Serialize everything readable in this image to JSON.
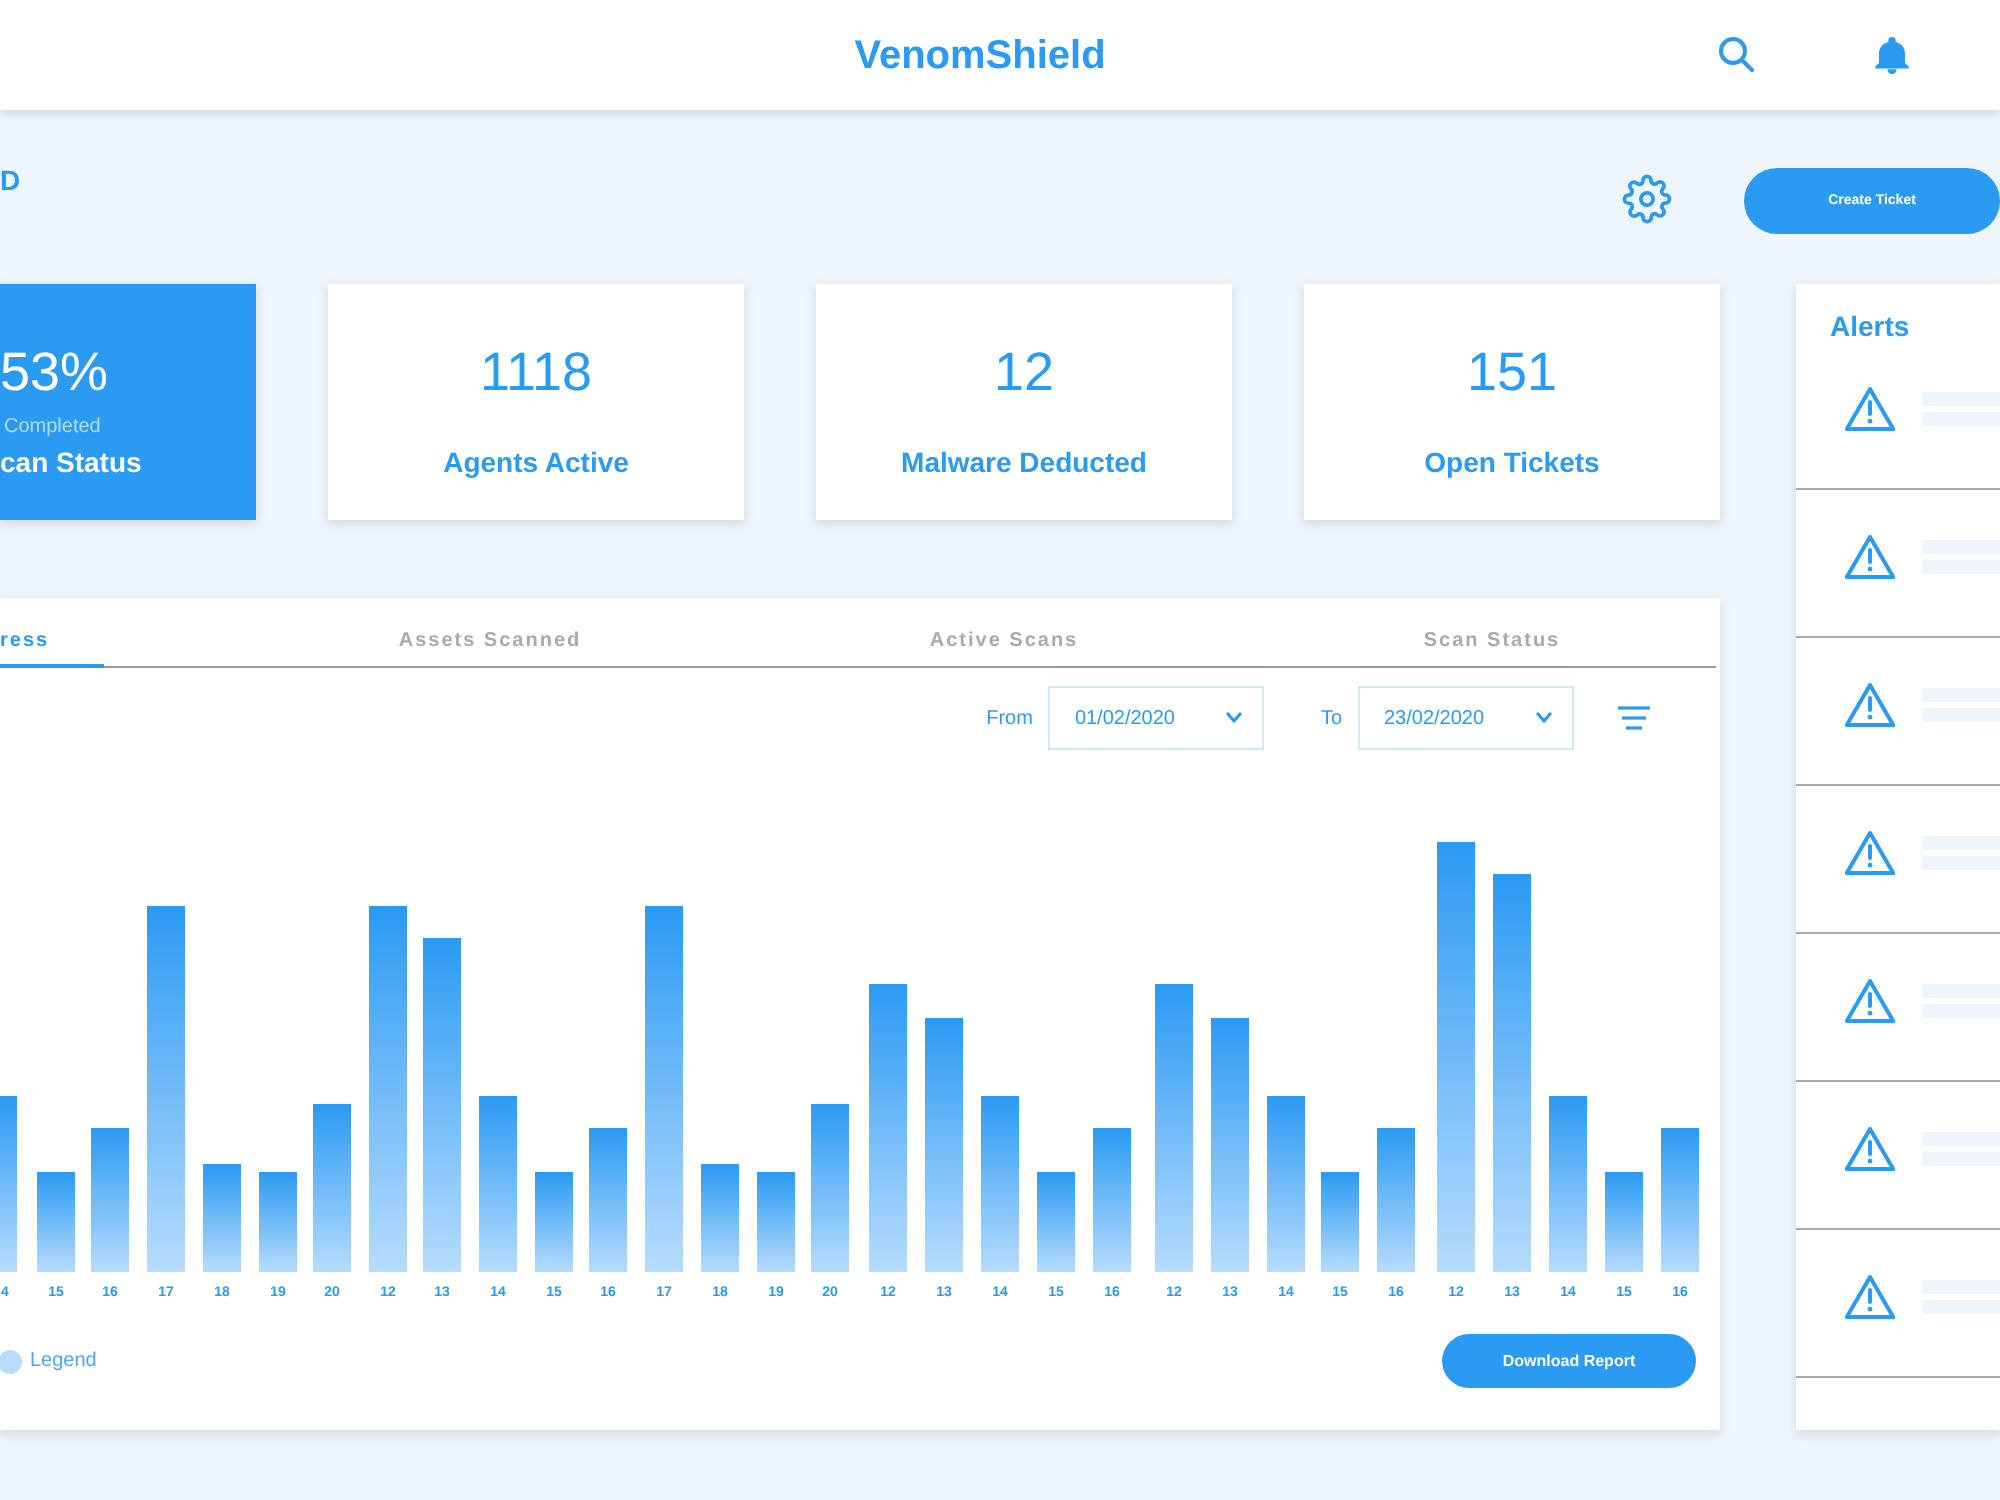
{
  "header": {
    "title": "VenomShield"
  },
  "toolbar": {
    "page_title": "D",
    "create_button": "Create Ticket"
  },
  "stats": [
    {
      "value": "53%",
      "caption": "Completed",
      "label": "can Status",
      "selected": true
    },
    {
      "value": "1118",
      "label": "Agents Active",
      "selected": false
    },
    {
      "value": "12",
      "label": "Malware Deducted",
      "selected": false
    },
    {
      "value": "151",
      "label": "Open Tickets",
      "selected": false
    }
  ],
  "chart_panel": {
    "tabs": [
      {
        "label": "ress",
        "selected": true
      },
      {
        "label": "Assets Scanned",
        "selected": false
      },
      {
        "label": "Active Scans",
        "selected": false
      },
      {
        "label": "Scan Status",
        "selected": false
      }
    ],
    "filter": {
      "from_label": "From",
      "from_value": "01/02/2020",
      "to_label": "To",
      "to_value": "23/02/2020"
    },
    "bar_labels": [
      "4",
      "15",
      "16",
      "17",
      "18",
      "19",
      "20",
      "12",
      "13",
      "14",
      "15",
      "16",
      "17",
      "18",
      "19",
      "20",
      "12",
      "13",
      "14",
      "15",
      "16",
      "12",
      "13",
      "14",
      "15",
      "16",
      "12",
      "13",
      "14",
      "15",
      "16"
    ],
    "legend": "Legend",
    "download_button": "Download Report"
  },
  "alerts": {
    "title": "Alerts",
    "items": [
      {
        "kind": "warning"
      },
      {
        "kind": "warning"
      },
      {
        "kind": "warning"
      },
      {
        "kind": "warning"
      },
      {
        "kind": "warning"
      },
      {
        "kind": "warning"
      },
      {
        "kind": "warning"
      }
    ]
  }
}
